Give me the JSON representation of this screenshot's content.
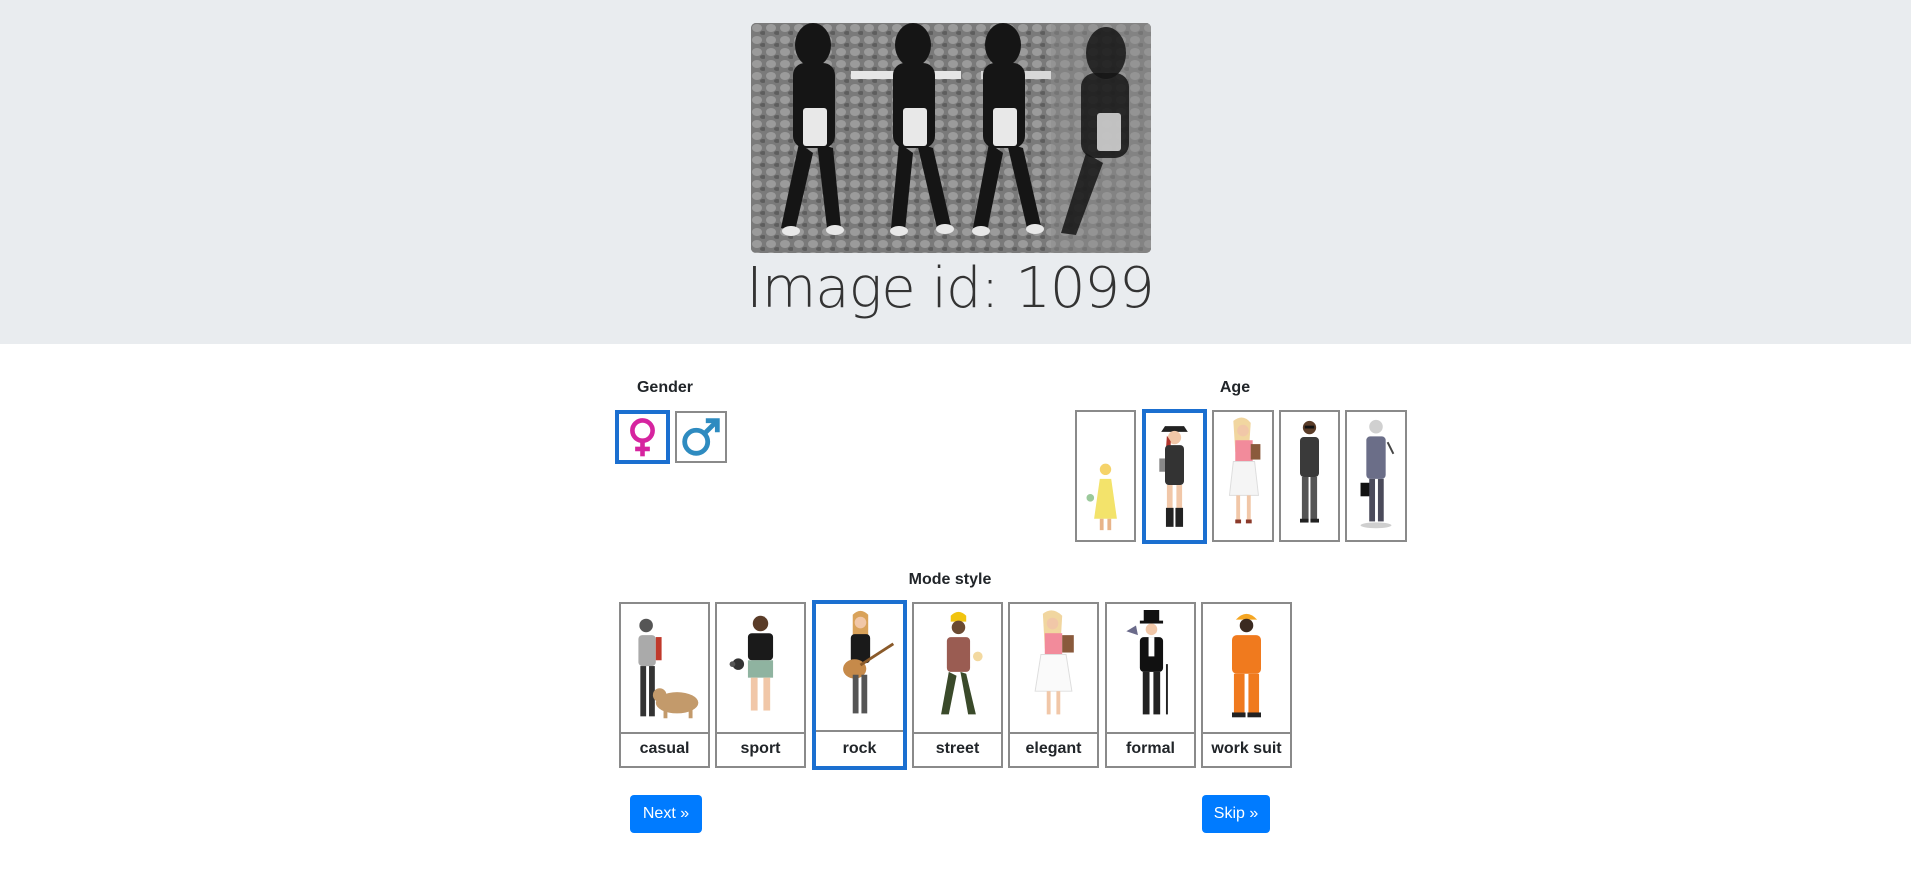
{
  "header": {
    "image_id_text": "Image id: 1099"
  },
  "gender": {
    "label": "Gender",
    "options": [
      {
        "icon": "female-symbol-icon",
        "selected": true,
        "color": "#d6249f"
      },
      {
        "icon": "male-symbol-icon",
        "selected": false,
        "color": "#2e8bc0"
      }
    ]
  },
  "age": {
    "label": "Age",
    "options": [
      {
        "icon": "child-figure-icon",
        "selected": false
      },
      {
        "icon": "teen-figure-icon",
        "selected": true
      },
      {
        "icon": "young-adult-figure-icon",
        "selected": false
      },
      {
        "icon": "adult-figure-icon",
        "selected": false
      },
      {
        "icon": "senior-figure-icon",
        "selected": false
      }
    ]
  },
  "mode_style": {
    "label": "Mode style",
    "options": [
      {
        "label": "casual",
        "selected": false
      },
      {
        "label": "sport",
        "selected": false
      },
      {
        "label": "rock",
        "selected": true
      },
      {
        "label": "street",
        "selected": false
      },
      {
        "label": "elegant",
        "selected": false
      },
      {
        "label": "formal",
        "selected": false
      },
      {
        "label": "work suit",
        "selected": false
      }
    ]
  },
  "actions": {
    "next_label": "Next »",
    "skip_label": "Skip »"
  },
  "colors": {
    "accent": "#007bff",
    "selected_border": "#1b6fd0",
    "jumbotron_bg": "#e9ecef"
  }
}
